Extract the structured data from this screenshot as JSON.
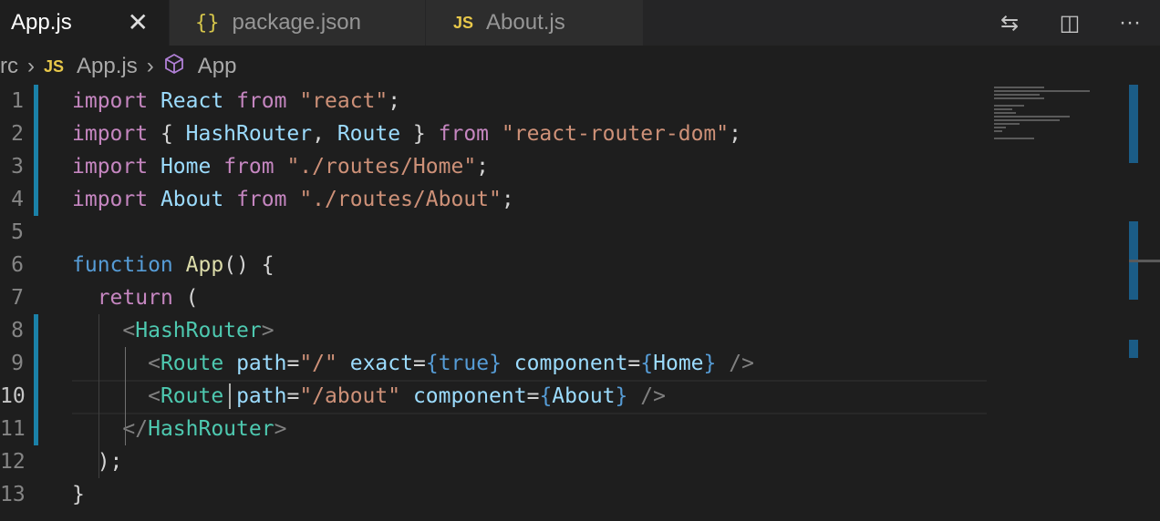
{
  "tabs": [
    {
      "label": "App.js",
      "icon": "JS",
      "active": true,
      "close": "✕"
    },
    {
      "label": "package.json",
      "icon": "{}",
      "active": false
    },
    {
      "label": "About.js",
      "icon": "JS",
      "active": false
    }
  ],
  "actions": [
    {
      "name": "compare-changes-icon",
      "glyph": "⇆"
    },
    {
      "name": "split-editor-icon",
      "glyph": "◫"
    },
    {
      "name": "more-actions-icon",
      "glyph": "···"
    }
  ],
  "breadcrumb": {
    "folder": "rc",
    "file_icon": "JS",
    "file": "App.js",
    "symbol": "App"
  },
  "editor": {
    "line_numbers": [
      "1",
      "2",
      "3",
      "4",
      "5",
      "6",
      "7",
      "8",
      "9",
      "10",
      "11",
      "12",
      "13"
    ],
    "current_line": "10",
    "lines": [
      [
        [
          "kw",
          "import"
        ],
        [
          "plain",
          " "
        ],
        [
          "id",
          "React"
        ],
        [
          "plain",
          " "
        ],
        [
          "kw",
          "from"
        ],
        [
          "plain",
          " "
        ],
        [
          "str",
          "\"react\""
        ],
        [
          "plain",
          ";"
        ]
      ],
      [
        [
          "kw",
          "import"
        ],
        [
          "plain",
          " { "
        ],
        [
          "id",
          "HashRouter"
        ],
        [
          "plain",
          ", "
        ],
        [
          "id",
          "Route"
        ],
        [
          "plain",
          " } "
        ],
        [
          "kw",
          "from"
        ],
        [
          "plain",
          " "
        ],
        [
          "str",
          "\"react-router-dom\""
        ],
        [
          "plain",
          ";"
        ]
      ],
      [
        [
          "kw",
          "import"
        ],
        [
          "plain",
          " "
        ],
        [
          "id",
          "Home"
        ],
        [
          "plain",
          " "
        ],
        [
          "kw",
          "from"
        ],
        [
          "plain",
          " "
        ],
        [
          "str",
          "\"./routes/Home\""
        ],
        [
          "plain",
          ";"
        ]
      ],
      [
        [
          "kw",
          "import"
        ],
        [
          "plain",
          " "
        ],
        [
          "id",
          "About"
        ],
        [
          "plain",
          " "
        ],
        [
          "kw",
          "from"
        ],
        [
          "plain",
          " "
        ],
        [
          "str",
          "\"./routes/About\""
        ],
        [
          "plain",
          ";"
        ]
      ],
      [],
      [
        [
          "kb",
          "function"
        ],
        [
          "plain",
          " "
        ],
        [
          "fn",
          "App"
        ],
        [
          "plain",
          "() {"
        ]
      ],
      [
        [
          "plain",
          "  "
        ],
        [
          "kw",
          "return"
        ],
        [
          "plain",
          " ("
        ]
      ],
      [
        [
          "plain",
          "    "
        ],
        [
          "pt",
          "<"
        ],
        [
          "tag",
          "HashRouter"
        ],
        [
          "pt",
          ">"
        ]
      ],
      [
        [
          "plain",
          "      "
        ],
        [
          "pt",
          "<"
        ],
        [
          "tag",
          "Route"
        ],
        [
          "plain",
          " "
        ],
        [
          "id",
          "path"
        ],
        [
          "plain",
          "="
        ],
        [
          "str",
          "\"/\""
        ],
        [
          "plain",
          " "
        ],
        [
          "id",
          "exact"
        ],
        [
          "plain",
          "="
        ],
        [
          "br",
          "{"
        ],
        [
          "kb",
          "true"
        ],
        [
          "br",
          "}"
        ],
        [
          "plain",
          " "
        ],
        [
          "id",
          "component"
        ],
        [
          "plain",
          "="
        ],
        [
          "br",
          "{"
        ],
        [
          "id",
          "Home"
        ],
        [
          "br",
          "}"
        ],
        [
          "plain",
          " "
        ],
        [
          "pt",
          "/>"
        ]
      ],
      [
        [
          "plain",
          "      "
        ],
        [
          "pt",
          "<"
        ],
        [
          "tag",
          "Route"
        ],
        [
          "plain",
          " "
        ],
        [
          "id",
          "path"
        ],
        [
          "plain",
          "="
        ],
        [
          "str",
          "\"/about\""
        ],
        [
          "plain",
          " "
        ],
        [
          "id",
          "component"
        ],
        [
          "plain",
          "="
        ],
        [
          "br",
          "{"
        ],
        [
          "id",
          "About"
        ],
        [
          "br",
          "}"
        ],
        [
          "plain",
          " "
        ],
        [
          "pt",
          "/>"
        ]
      ],
      [
        [
          "plain",
          "    "
        ],
        [
          "pt",
          "</"
        ],
        [
          "tag",
          "HashRouter"
        ],
        [
          "pt",
          ">"
        ]
      ],
      [
        [
          "plain",
          "  );"
        ]
      ],
      [
        [
          "plain",
          "}"
        ]
      ]
    ],
    "modified_lines": [
      "1",
      "2",
      "3",
      "4",
      "8",
      "9",
      "10",
      "11"
    ]
  },
  "minimap": {
    "rows": [
      0.5,
      0.95,
      0.45,
      0.5,
      0,
      0.3,
      0.18,
      0.22,
      0.75,
      0.65,
      0.25,
      0.12,
      0.08,
      0,
      0.4
    ]
  },
  "colors": {
    "background": "#1e1e1e",
    "modified_gutter": "#1b81a8",
    "keyword": "#c586c0",
    "string": "#ce9178",
    "tag": "#4ec9b0"
  }
}
